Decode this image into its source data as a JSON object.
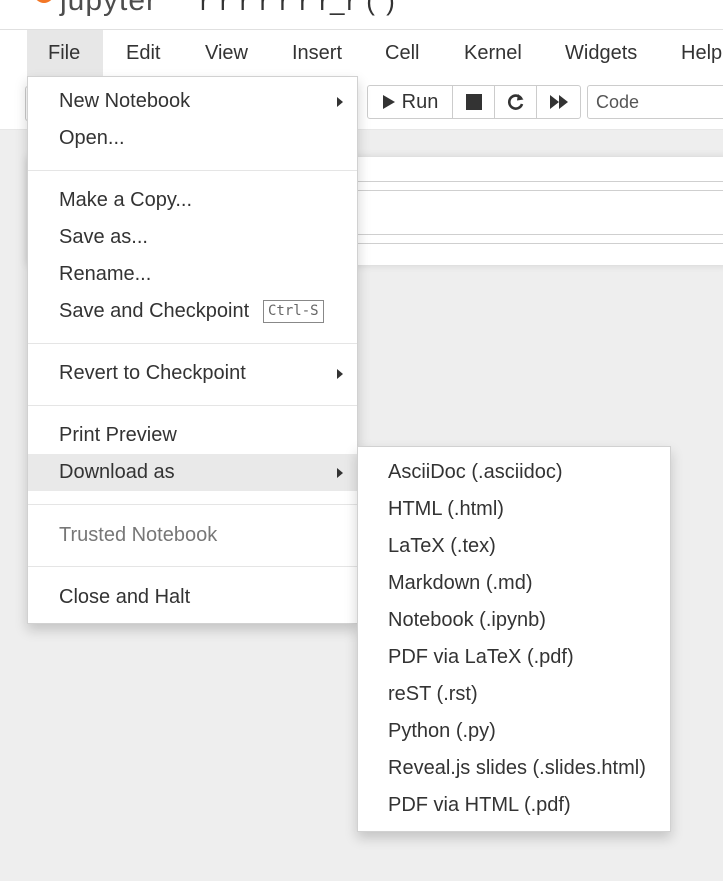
{
  "header": {
    "logo_text": "jupyter",
    "title_fragment": "r  r  r  r    r    r    r_r  (    )"
  },
  "menubar": {
    "items": [
      "File",
      "Edit",
      "View",
      "Insert",
      "Cell",
      "Kernel",
      "Widgets",
      "Help"
    ],
    "open_item": "File"
  },
  "toolbar": {
    "run_label": "Run",
    "cell_type": "Code"
  },
  "file_menu": {
    "items": [
      {
        "label": "New Notebook",
        "submenu": true
      },
      {
        "label": "Open..."
      },
      {
        "label": "Make a Copy..."
      },
      {
        "label": "Save as..."
      },
      {
        "label": "Rename..."
      },
      {
        "label": "Save and Checkpoint",
        "shortcut": "Ctrl-S"
      },
      {
        "label": "Revert to Checkpoint",
        "submenu": true
      },
      {
        "label": "Print Preview"
      },
      {
        "label": "Download as",
        "submenu": true,
        "active": true
      },
      {
        "label": "Trusted Notebook",
        "disabled": true
      },
      {
        "label": "Close and Halt"
      }
    ]
  },
  "download_menu": {
    "items": [
      "AsciiDoc (.asciidoc)",
      "HTML (.html)",
      "LaTeX (.tex)",
      "Markdown (.md)",
      "Notebook (.ipynb)",
      "PDF via LaTeX (.pdf)",
      "reST (.rst)",
      "Python (.py)",
      "Reveal.js slides (.slides.html)",
      "PDF via HTML (.pdf)"
    ]
  },
  "colors": {
    "logo_orange": "#f37726",
    "menu_hover": "#e9e9e9",
    "background": "#eeeeee"
  }
}
